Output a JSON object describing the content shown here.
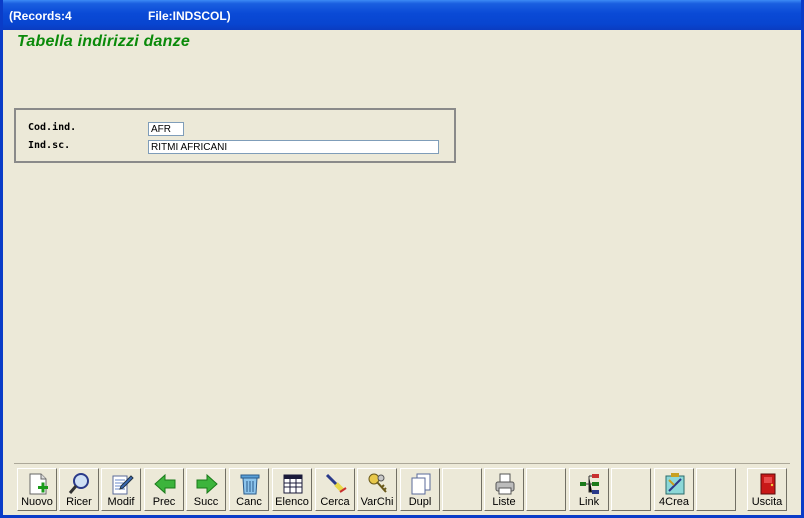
{
  "titlebar": {
    "records": "(Records:4",
    "file": "File:INDSCOL)"
  },
  "form": {
    "title": "Tabella indirizzi danze"
  },
  "fields": {
    "cod_label": "Cod.ind.",
    "cod_value": "AFR",
    "ind_label": "Ind.sc.",
    "ind_value": "RITMI AFRICANI"
  },
  "toolbar": {
    "nuovo": "Nuovo",
    "ricer": "Ricer",
    "modif": "Modif",
    "prec": "Prec",
    "succ": "Succ",
    "canc": "Canc",
    "elenco": "Elenco",
    "cerca": "Cerca",
    "varchi": "VarChi",
    "dupl": "Dupl",
    "liste": "Liste",
    "link": "Link",
    "crea": "4Crea",
    "uscita": "Uscita"
  },
  "icons": [
    "new-record-icon",
    "search-icon",
    "edit-icon",
    "arrow-left-icon",
    "arrow-right-icon",
    "trash-icon",
    "table-icon",
    "find-icon",
    "keys-icon",
    "duplicate-icon",
    "printer-icon",
    "tree-link-icon",
    "build-icon",
    "exit-door-icon"
  ]
}
